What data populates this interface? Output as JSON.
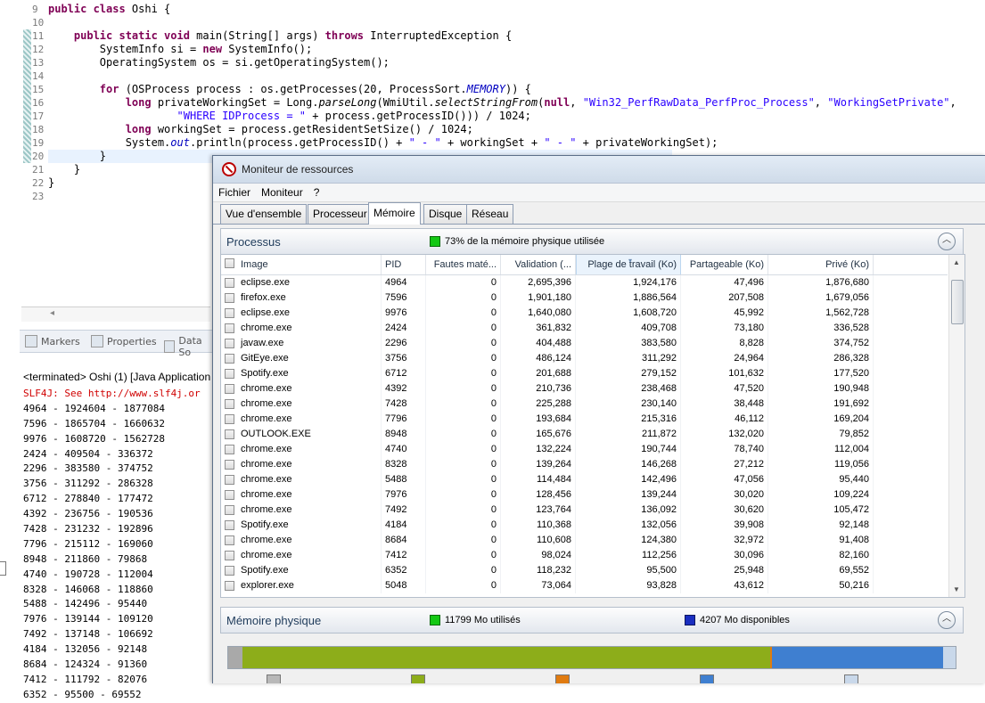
{
  "editor": {
    "lines": [
      {
        "n": "9",
        "html": "<span class='kw'>public class</span> Oshi {"
      },
      {
        "n": "10",
        "html": ""
      },
      {
        "n": "11",
        "html": "    <span class='kw'>public static void</span> main(String[] args) <span class='kw'>throws</span> InterruptedException {"
      },
      {
        "n": "12",
        "html": "        SystemInfo si = <span class='kw'>new</span> SystemInfo();"
      },
      {
        "n": "13",
        "html": "        OperatingSystem os = si.getOperatingSystem();"
      },
      {
        "n": "14",
        "html": ""
      },
      {
        "n": "15",
        "html": "        <span class='kw'>for</span> (OSProcess process : os.getProcesses(20, ProcessSort.<span class='fld'>MEMORY</span>)) {"
      },
      {
        "n": "16",
        "html": "            <span class='kw'>long</span> privateWorkingSet = Long.<span class='it'>parseLong</span>(WmiUtil.<span class='it'>selectStringFrom</span>(<span class='kw'>null</span>, <span class='str'>\"Win32_PerfRawData_PerfProc_Process\"</span>, <span class='str'>\"WorkingSetPrivate\"</span>,"
      },
      {
        "n": "17",
        "html": "                    <span class='str'>\"WHERE IDProcess = \"</span> + process.getProcessID())) / 1024;"
      },
      {
        "n": "18",
        "html": "            <span class='kw'>long</span> workingSet = process.getResidentSetSize() / 1024;"
      },
      {
        "n": "19",
        "html": "            System.<span class='fld'>out</span>.println(process.getProcessID() + <span class='str'>\" - \"</span> + workingSet + <span class='str'>\" - \"</span> + privateWorkingSet);"
      },
      {
        "n": "20",
        "html": "        }"
      },
      {
        "n": "21",
        "html": "    }"
      },
      {
        "n": "22",
        "html": "}"
      },
      {
        "n": "23",
        "html": ""
      }
    ]
  },
  "views": {
    "tabs": [
      "Markers",
      "Properties",
      "Data So"
    ]
  },
  "console": {
    "title": "<terminated> Oshi (1) [Java Application",
    "error_line": "SLF4J: See http://www.slf4j.or",
    "lines": [
      "4964 - 1924604 - 1877084",
      "7596 - 1865704 - 1660632",
      "9976 - 1608720 - 1562728",
      "2424 - 409504 - 336372",
      "2296 - 383580 - 374752",
      "3756 - 311292 - 286328",
      "6712 - 278840 - 177472",
      "4392 - 236756 - 190536",
      "7428 - 231232 - 192896",
      "7796 - 215112 - 169060",
      "8948 - 211860 - 79868",
      "4740 - 190728 - 112004",
      "8328 - 146068 - 118860",
      "5488 - 142496 - 95440",
      "7976 - 139144 - 109120",
      "7492 - 137148 - 106692",
      "4184 - 132056 - 92148",
      "8684 - 124324 - 91360",
      "7412 - 111792 - 82076",
      "6352 - 95500 - 69552"
    ]
  },
  "resmon": {
    "title": "Moniteur de ressources",
    "menu": [
      "Fichier",
      "Moniteur",
      "?"
    ],
    "tabs": [
      "Vue d'ensemble",
      "Processeur",
      "Mémoire",
      "Disque",
      "Réseau"
    ],
    "active_tab": "Mémoire",
    "processes": {
      "title": "Processus",
      "summary": "73% de la mémoire physique utilisée",
      "columns": [
        "Image",
        "PID",
        "Fautes maté...",
        "Validation (...",
        "Plage de travail (Ko)",
        "Partageable (Ko)",
        "Privé (Ko)"
      ],
      "rows": [
        [
          "eclipse.exe",
          "4964",
          "0",
          "2,695,396",
          "1,924,176",
          "47,496",
          "1,876,680"
        ],
        [
          "firefox.exe",
          "7596",
          "0",
          "1,901,180",
          "1,886,564",
          "207,508",
          "1,679,056"
        ],
        [
          "eclipse.exe",
          "9976",
          "0",
          "1,640,080",
          "1,608,720",
          "45,992",
          "1,562,728"
        ],
        [
          "chrome.exe",
          "2424",
          "0",
          "361,832",
          "409,708",
          "73,180",
          "336,528"
        ],
        [
          "javaw.exe",
          "2296",
          "0",
          "404,488",
          "383,580",
          "8,828",
          "374,752"
        ],
        [
          "GitEye.exe",
          "3756",
          "0",
          "486,124",
          "311,292",
          "24,964",
          "286,328"
        ],
        [
          "Spotify.exe",
          "6712",
          "0",
          "201,688",
          "279,152",
          "101,632",
          "177,520"
        ],
        [
          "chrome.exe",
          "4392",
          "0",
          "210,736",
          "238,468",
          "47,520",
          "190,948"
        ],
        [
          "chrome.exe",
          "7428",
          "0",
          "225,288",
          "230,140",
          "38,448",
          "191,692"
        ],
        [
          "chrome.exe",
          "7796",
          "0",
          "193,684",
          "215,316",
          "46,112",
          "169,204"
        ],
        [
          "OUTLOOK.EXE",
          "8948",
          "0",
          "165,676",
          "211,872",
          "132,020",
          "79,852"
        ],
        [
          "chrome.exe",
          "4740",
          "0",
          "132,224",
          "190,744",
          "78,740",
          "112,004"
        ],
        [
          "chrome.exe",
          "8328",
          "0",
          "139,264",
          "146,268",
          "27,212",
          "119,056"
        ],
        [
          "chrome.exe",
          "5488",
          "0",
          "114,484",
          "142,496",
          "47,056",
          "95,440"
        ],
        [
          "chrome.exe",
          "7976",
          "0",
          "128,456",
          "139,244",
          "30,020",
          "109,224"
        ],
        [
          "chrome.exe",
          "7492",
          "0",
          "123,764",
          "136,092",
          "30,620",
          "105,472"
        ],
        [
          "Spotify.exe",
          "4184",
          "0",
          "110,368",
          "132,056",
          "39,908",
          "92,148"
        ],
        [
          "chrome.exe",
          "8684",
          "0",
          "110,608",
          "124,380",
          "32,972",
          "91,408"
        ],
        [
          "chrome.exe",
          "7412",
          "0",
          "98,024",
          "112,256",
          "30,096",
          "82,160"
        ],
        [
          "Spotify.exe",
          "6352",
          "0",
          "118,232",
          "95,500",
          "25,948",
          "69,552"
        ],
        [
          "explorer.exe",
          "5048",
          "0",
          "73,064",
          "93,828",
          "43,612",
          "50,216"
        ]
      ]
    },
    "physical": {
      "title": "Mémoire physique",
      "used": "11799 Mo utilisés",
      "available": "4207 Mo disponibles",
      "bar": [
        {
          "name": "reserved",
          "fraction": 0.02,
          "color": "#a9a9a9"
        },
        {
          "name": "in-use",
          "fraction": 0.74,
          "color": "#8dad1a"
        },
        {
          "name": "modified",
          "fraction": 0.003,
          "color": "#e07b10"
        },
        {
          "name": "standby",
          "fraction": 0.24,
          "color": "#3f7fd0"
        },
        {
          "name": "free",
          "fraction": 0.017,
          "color": "#c9d8ea"
        }
      ],
      "legend_colors": [
        "#b8b8b8",
        "#8dad1a",
        "#e07b10",
        "#3f7fd0",
        "#c9d8ea"
      ]
    }
  }
}
